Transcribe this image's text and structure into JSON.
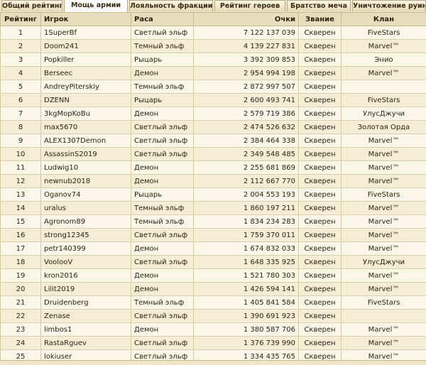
{
  "tabs": [
    {
      "label": "Общий рейтинг",
      "active": false
    },
    {
      "label": "Мощь армии",
      "active": true
    },
    {
      "label": "Лояльность фракции",
      "active": false
    },
    {
      "label": "Рейтинг героев",
      "active": false
    },
    {
      "label": "Братство меча",
      "active": false
    },
    {
      "label": "Уничтожение руин",
      "active": false
    }
  ],
  "table": {
    "headers": {
      "rank": "Рейтинг",
      "player": "Игрок",
      "race": "Раса",
      "points": "Очки",
      "title": "Звание",
      "clan": "Клан"
    },
    "rows": [
      {
        "rank": "1",
        "player": "1SuperBf",
        "race": "Светлый эльф",
        "points": "7 122 137 039",
        "title": "Скверен",
        "clan": "FiveStars"
      },
      {
        "rank": "2",
        "player": "Doom241",
        "race": "Темный эльф",
        "points": "4 139 227 831",
        "title": "Скверен",
        "clan": "Marvel™"
      },
      {
        "rank": "3",
        "player": "Popkiller",
        "race": "Рыцарь",
        "points": "3 392 309 853",
        "title": "Скверен",
        "clan": "Энио"
      },
      {
        "rank": "4",
        "player": "Berseec",
        "race": "Демон",
        "points": "2 954 994 198",
        "title": "Скверен",
        "clan": "Marvel™"
      },
      {
        "rank": "5",
        "player": "AndreyPiterskiy",
        "race": "Темный эльф",
        "points": "2 872 997 507",
        "title": "Скверен",
        "clan": ""
      },
      {
        "rank": "6",
        "player": "DZENN",
        "race": "Рыцарь",
        "points": "2 600 493 741",
        "title": "Скверен",
        "clan": "FiveStars"
      },
      {
        "rank": "7",
        "player": "3kgMopKoBu",
        "race": "Демон",
        "points": "2 579 719 386",
        "title": "Скверен",
        "clan": "УлусДжучи"
      },
      {
        "rank": "8",
        "player": "max5670",
        "race": "Светлый эльф",
        "points": "2 474 526 632",
        "title": "Скверен",
        "clan": "Золотая Орда"
      },
      {
        "rank": "9",
        "player": "ALEX1307Demon",
        "race": "Светлый эльф",
        "points": "2 384 464 338",
        "title": "Скверен",
        "clan": "Marvel™"
      },
      {
        "rank": "10",
        "player": "AssassinS2019",
        "race": "Светлый эльф",
        "points": "2 349 548 485",
        "title": "Скверен",
        "clan": "Marvel™"
      },
      {
        "rank": "11",
        "player": "Ludwig10",
        "race": "Демон",
        "points": "2 255 681 869",
        "title": "Скверен",
        "clan": "Marvel™"
      },
      {
        "rank": "12",
        "player": "newnub2018",
        "race": "Демон",
        "points": "2 112 667 770",
        "title": "Скверен",
        "clan": "Marvel™"
      },
      {
        "rank": "13",
        "player": "Oganov74",
        "race": "Рыцарь",
        "points": "2 004 553 193",
        "title": "Скверен",
        "clan": "FiveStars"
      },
      {
        "rank": "14",
        "player": "uralus",
        "race": "Темный эльф",
        "points": "1 860 197 211",
        "title": "Скверен",
        "clan": "Marvel™"
      },
      {
        "rank": "15",
        "player": "Agronom89",
        "race": "Темный эльф",
        "points": "1 834 234 283",
        "title": "Скверен",
        "clan": "Marvel™"
      },
      {
        "rank": "16",
        "player": "strong12345",
        "race": "Светлый эльф",
        "points": "1 759 370 011",
        "title": "Скверен",
        "clan": "Marvel™"
      },
      {
        "rank": "17",
        "player": "petr140399",
        "race": "Демон",
        "points": "1 674 832 033",
        "title": "Скверен",
        "clan": "Marvel™"
      },
      {
        "rank": "18",
        "player": "VoolooV",
        "race": "Светлый эльф",
        "points": "1 648 335 925",
        "title": "Скверен",
        "clan": "УлусДжучи"
      },
      {
        "rank": "19",
        "player": "kron2016",
        "race": "Демон",
        "points": "1 521 780 303",
        "title": "Скверен",
        "clan": "Marvel™"
      },
      {
        "rank": "20",
        "player": "Lilit2019",
        "race": "Демон",
        "points": "1 426 594 141",
        "title": "Скверен",
        "clan": "Marvel™"
      },
      {
        "rank": "21",
        "player": "Druidenberg",
        "race": "Темный эльф",
        "points": "1 405 841 584",
        "title": "Скверен",
        "clan": "FiveStars"
      },
      {
        "rank": "22",
        "player": "Zenase",
        "race": "Светлый эльф",
        "points": "1 390 691 923",
        "title": "Скверен",
        "clan": ""
      },
      {
        "rank": "23",
        "player": "limbos1",
        "race": "Демон",
        "points": "1 380 587 706",
        "title": "Скверен",
        "clan": "Marvel™"
      },
      {
        "rank": "24",
        "player": "RastaRguev",
        "race": "Светлый эльф",
        "points": "1 376 739 990",
        "title": "Скверен",
        "clan": "Marvel™"
      },
      {
        "rank": "25",
        "player": "lokiuser",
        "race": "Светлый эльф",
        "points": "1 334 435 765",
        "title": "Скверен",
        "clan": "Marvel™"
      }
    ]
  }
}
